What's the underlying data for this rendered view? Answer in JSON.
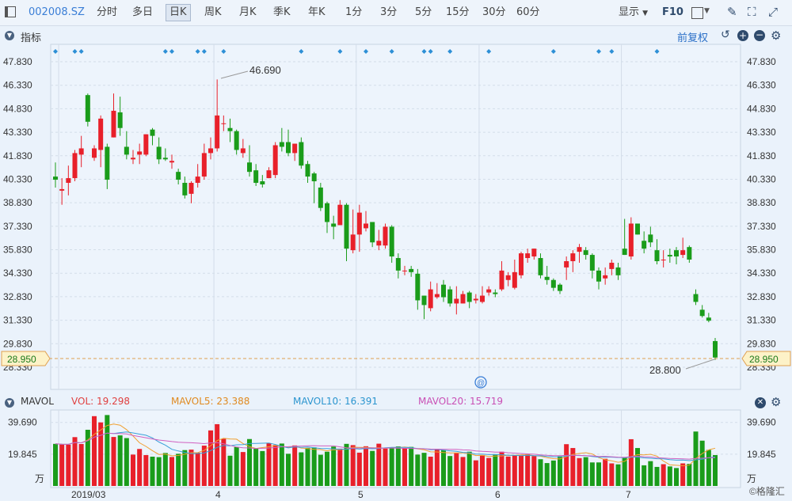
{
  "toolbar": {
    "code": "002008.SZ",
    "periods": [
      "分时",
      "多日",
      "日K",
      "周K",
      "月K",
      "季K",
      "年K",
      "1分",
      "3分",
      "5分",
      "15分",
      "30分",
      "60分"
    ],
    "active_period": "日K",
    "display_label": "显示",
    "f10_label": "F10"
  },
  "indicator_bar": {
    "label": "指标",
    "adjust_label": "前复权"
  },
  "price_axis": {
    "ticks": [
      "47.830",
      "46.330",
      "44.830",
      "43.330",
      "41.830",
      "40.330",
      "38.830",
      "37.330",
      "35.830",
      "34.330",
      "32.830",
      "31.330",
      "29.830",
      "28.330"
    ],
    "current_price": "28.950",
    "high_label": "46.690",
    "low_label": "28.800"
  },
  "volume_panel": {
    "label": "MAVOL",
    "vol": "VOL: 19.298",
    "mavol5": "MAVOL5: 23.388",
    "mavol10": "MAVOL10: 16.391",
    "mavol20": "MAVOL20: 15.719",
    "ticks": [
      "39.690",
      "19.845"
    ],
    "unit": "万"
  },
  "x_axis": {
    "labels": [
      "2019/03",
      "4",
      "5",
      "6",
      "7"
    ]
  },
  "watermark": "©格隆汇",
  "colors": {
    "up": "#e8202a",
    "down": "#1a9c1a",
    "ma5": "#f0a030",
    "ma10": "#3aa0d8",
    "ma20": "#d060c0",
    "accent": "#3a7ed6"
  },
  "chart_data": {
    "type": "candlestick",
    "price_ylim": [
      28.33,
      47.83
    ],
    "candles": [
      [
        40.5,
        40.3,
        41.4,
        39.8
      ],
      [
        39.6,
        39.7,
        40.4,
        38.7
      ],
      [
        40.1,
        40.4,
        41.2,
        39.3
      ],
      [
        40.4,
        42.0,
        42.2,
        40.2
      ],
      [
        41.9,
        42.3,
        43.1,
        41.1
      ],
      [
        45.7,
        44.0,
        45.8,
        43.7
      ],
      [
        41.7,
        42.3,
        42.5,
        41.5
      ],
      [
        42.2,
        44.2,
        44.4,
        41.1
      ],
      [
        42.4,
        40.3,
        42.6,
        39.7
      ],
      [
        43.0,
        44.7,
        45.8,
        43.0
      ],
      [
        44.6,
        43.6,
        45.6,
        43.1
      ],
      [
        42.4,
        41.9,
        43.4,
        41.6
      ],
      [
        41.6,
        41.7,
        42.2,
        41.3
      ],
      [
        41.9,
        42.1,
        42.6,
        41.3
      ],
      [
        41.9,
        43.2,
        43.2,
        41.8
      ],
      [
        43.5,
        43.1,
        43.6,
        42.5
      ],
      [
        42.4,
        41.6,
        43.0,
        41.3
      ],
      [
        41.7,
        41.6,
        42.3,
        41.5
      ],
      [
        41.4,
        41.5,
        41.9,
        41.0
      ],
      [
        40.8,
        40.3,
        41.0,
        40.0
      ],
      [
        40.1,
        39.3,
        40.5,
        39.1
      ],
      [
        39.4,
        40.1,
        40.2,
        38.8
      ],
      [
        40.1,
        40.5,
        41.3,
        39.8
      ],
      [
        40.5,
        42.0,
        42.6,
        40.3
      ],
      [
        42.0,
        42.3,
        43.0,
        41.6
      ],
      [
        42.3,
        44.4,
        46.7,
        42.1
      ],
      [
        43.9,
        43.9,
        44.4,
        43.4
      ],
      [
        43.6,
        43.4,
        44.2,
        42.7
      ],
      [
        43.4,
        42.2,
        43.5,
        41.9
      ],
      [
        42.0,
        42.3,
        42.9,
        41.7
      ],
      [
        41.4,
        40.8,
        42.5,
        40.5
      ],
      [
        40.9,
        40.1,
        41.3,
        39.9
      ],
      [
        40.2,
        40.0,
        40.6,
        39.8
      ],
      [
        40.4,
        40.9,
        41.1,
        40.4
      ],
      [
        40.6,
        42.5,
        42.7,
        40.4
      ],
      [
        42.7,
        42.4,
        43.6,
        42.1
      ],
      [
        42.7,
        42.0,
        43.5,
        41.8
      ],
      [
        42.0,
        42.6,
        42.6,
        41.5
      ],
      [
        42.7,
        41.2,
        43.0,
        41.0
      ],
      [
        41.3,
        40.5,
        41.5,
        40.1
      ],
      [
        40.7,
        40.2,
        40.8,
        38.8
      ],
      [
        39.8,
        38.5,
        40.1,
        38.3
      ],
      [
        38.8,
        37.6,
        38.9,
        36.9
      ],
      [
        37.5,
        37.3,
        38.0,
        36.5
      ],
      [
        37.4,
        38.7,
        39.0,
        37.4
      ],
      [
        38.7,
        35.9,
        38.8,
        35.1
      ],
      [
        35.8,
        36.8,
        38.4,
        35.6
      ],
      [
        36.8,
        38.2,
        38.7,
        35.7
      ],
      [
        37.2,
        37.5,
        38.3,
        37.0
      ],
      [
        37.6,
        36.3,
        37.6,
        36.0
      ],
      [
        36.1,
        36.4,
        37.1,
        35.8
      ],
      [
        36.1,
        37.3,
        37.5,
        35.9
      ],
      [
        37.3,
        35.4,
        37.4,
        35.0
      ],
      [
        35.3,
        34.5,
        35.6,
        34.0
      ],
      [
        34.5,
        34.5,
        34.8,
        34.2
      ],
      [
        34.6,
        34.4,
        34.8,
        34.1
      ],
      [
        34.3,
        32.6,
        34.6,
        32.0
      ],
      [
        32.9,
        32.3,
        32.9,
        31.4
      ],
      [
        32.1,
        33.3,
        33.8,
        31.9
      ],
      [
        32.8,
        33.0,
        33.7,
        32.7
      ],
      [
        33.6,
        32.8,
        33.9,
        32.5
      ],
      [
        33.3,
        32.4,
        33.5,
        32.2
      ],
      [
        32.4,
        32.7,
        33.5,
        31.7
      ],
      [
        32.4,
        33.0,
        33.2,
        32.4
      ],
      [
        33.1,
        32.5,
        33.2,
        32.1
      ],
      [
        32.6,
        32.7,
        33.0,
        32.4
      ],
      [
        32.5,
        32.9,
        33.5,
        32.4
      ],
      [
        33.1,
        33.3,
        33.5,
        32.9
      ],
      [
        33.1,
        33.0,
        33.3,
        32.8
      ],
      [
        33.3,
        34.5,
        35.1,
        33.2
      ],
      [
        33.9,
        34.2,
        34.4,
        33.5
      ],
      [
        33.4,
        34.4,
        35.2,
        33.3
      ],
      [
        34.2,
        35.6,
        35.7,
        34.0
      ],
      [
        35.3,
        35.6,
        35.9,
        35.0
      ],
      [
        35.4,
        35.9,
        35.9,
        35.2
      ],
      [
        35.3,
        34.2,
        35.6,
        34.0
      ],
      [
        34.1,
        33.9,
        34.8,
        33.6
      ],
      [
        33.9,
        33.4,
        34.0,
        33.2
      ],
      [
        33.6,
        33.2,
        33.7,
        33.0
      ],
      [
        34.7,
        35.1,
        35.4,
        33.9
      ],
      [
        35.1,
        35.6,
        35.8,
        34.4
      ],
      [
        35.7,
        36.0,
        36.2,
        35.0
      ],
      [
        35.8,
        35.5,
        36.0,
        35.2
      ],
      [
        35.5,
        34.5,
        35.6,
        34.0
      ],
      [
        34.5,
        33.8,
        34.7,
        33.3
      ],
      [
        34.0,
        34.2,
        34.7,
        33.6
      ],
      [
        34.6,
        35.0,
        35.2,
        34.2
      ],
      [
        34.7,
        34.2,
        35.0,
        33.9
      ],
      [
        35.9,
        35.5,
        37.8,
        35.5
      ],
      [
        35.4,
        37.5,
        37.9,
        35.2
      ],
      [
        37.5,
        36.8,
        37.5,
        36.8
      ],
      [
        36.4,
        35.9,
        37.0,
        35.6
      ],
      [
        36.8,
        36.3,
        37.3,
        36.0
      ],
      [
        35.8,
        35.1,
        36.5,
        34.9
      ],
      [
        35.2,
        35.2,
        35.8,
        34.7
      ],
      [
        35.5,
        35.4,
        35.9,
        35.0
      ],
      [
        35.8,
        35.4,
        36.0,
        34.9
      ],
      [
        35.5,
        35.8,
        36.6,
        35.3
      ],
      [
        36.0,
        35.2,
        36.1,
        35.0
      ],
      [
        33.0,
        32.5,
        33.3,
        32.3
      ],
      [
        32.0,
        31.6,
        32.3,
        31.5
      ],
      [
        31.5,
        31.3,
        31.8,
        31.2
      ],
      [
        30.0,
        28.95,
        30.2,
        28.8
      ]
    ],
    "volume_ylim": [
      0,
      44.0
    ],
    "volumes": [
      26.3,
      25.9,
      25.8,
      30.5,
      26.2,
      35.1,
      43.6,
      39.7,
      44.3,
      30.6,
      31.6,
      29.9,
      19.6,
      23.1,
      19.3,
      18.3,
      18.0,
      20.6,
      18.1,
      20.1,
      22.4,
      22.7,
      20.8,
      25.2,
      34.7,
      38.6,
      29.4,
      18.9,
      24.4,
      21.2,
      29.3,
      23.3,
      21.8,
      26.7,
      25.6,
      26.5,
      20.1,
      25.3,
      21.0,
      23.8,
      24.1,
      19.5,
      21.4,
      24.6,
      23.3,
      26.3,
      25.5,
      20.8,
      24.8,
      21.9,
      26.4,
      23.3,
      23.8,
      24.7,
      23.5,
      24.4,
      19.6,
      20.7,
      18.3,
      23.2,
      22.4,
      18.7,
      20.8,
      18.1,
      21.4,
      16.0,
      19.3,
      17.5,
      19.6,
      21.4,
      18.4,
      19.0,
      18.8,
      19.8,
      18.7,
      16.7,
      14.3,
      15.9,
      18.6,
      26.1,
      23.7,
      17.4,
      18.0,
      14.7,
      14.7,
      17.0,
      14.1,
      13.5,
      17.5,
      29.2,
      23.7,
      12.9,
      15.5,
      11.9,
      13.6,
      12.2,
      11.2,
      14.1,
      13.8,
      34.0,
      28.3,
      22.5,
      19.3
    ],
    "x_labels": [
      "2019/03",
      "4",
      "5",
      "6",
      "7"
    ],
    "events": [
      0,
      3,
      4,
      17,
      18,
      22,
      23,
      26,
      38,
      44,
      48,
      52,
      57,
      58,
      61,
      67,
      77,
      84,
      86,
      93
    ]
  }
}
